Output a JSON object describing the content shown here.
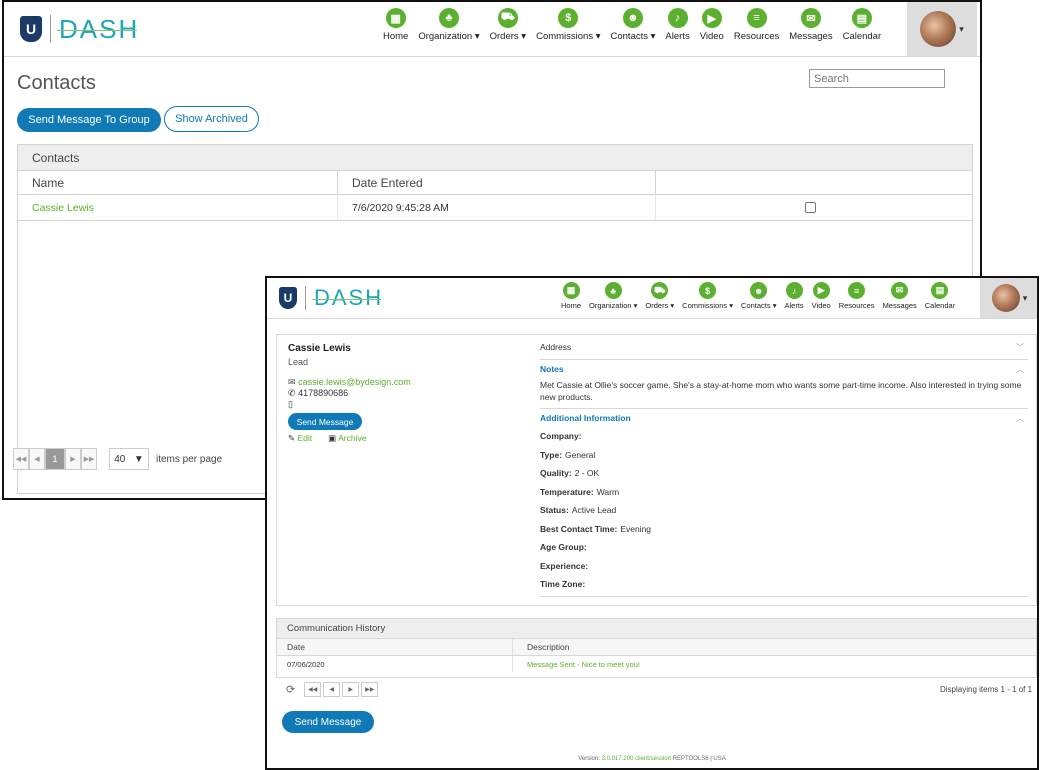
{
  "app": {
    "logo_mark": "U",
    "logo_text": "DASH"
  },
  "nav": [
    {
      "label": "Home",
      "icon": "home-icon",
      "glyph": "▦"
    },
    {
      "label": "Organization ▾",
      "icon": "organization-icon",
      "glyph": "♣"
    },
    {
      "label": "Orders ▾",
      "icon": "orders-icon",
      "glyph": "⛟"
    },
    {
      "label": "Commissions ▾",
      "icon": "commissions-icon",
      "glyph": "$"
    },
    {
      "label": "Contacts ▾",
      "icon": "contacts-icon",
      "glyph": "☻"
    },
    {
      "label": "Alerts",
      "icon": "alerts-icon",
      "glyph": "♪"
    },
    {
      "label": "Video",
      "icon": "video-icon",
      "glyph": "▶"
    },
    {
      "label": "Resources",
      "icon": "resources-icon",
      "glyph": "≡"
    },
    {
      "label": "Messages",
      "icon": "messages-icon",
      "glyph": "✉"
    },
    {
      "label": "Calendar",
      "icon": "calendar-icon",
      "glyph": "▤"
    }
  ],
  "contacts_page": {
    "title": "Contacts",
    "search_placeholder": "Search",
    "send_group_label": "Send Message To Group",
    "show_archived_label": "Show Archived",
    "grid_title": "Contacts",
    "columns": [
      "Name",
      "Date Entered",
      ""
    ],
    "rows": [
      {
        "name": "Cassie Lewis",
        "date": "7/6/2020 9:45:28 AM",
        "checked": false
      }
    ],
    "pager": {
      "current_page": "1",
      "page_size": "40",
      "items_label": "items per page"
    }
  },
  "contact_detail": {
    "name": "Cassie Lewis",
    "type": "Lead",
    "email": "cassie.lewis@bydesign.com",
    "phone": "4178890686",
    "mobile": "",
    "send_message_label": "Send Message",
    "edit_label": "Edit",
    "archive_label": "Archive",
    "address_label": "Address",
    "notes_label": "Notes",
    "notes_text": "Met Cassie at Ollie's soccer game. She's a stay-at-home mom who wants some part-time income. Also interested in trying some new products.",
    "additional_label": "Additional Information",
    "fields": [
      {
        "label": "Company:",
        "value": ""
      },
      {
        "label": "Type:",
        "value": "General"
      },
      {
        "label": "Quality:",
        "value": "2 - OK"
      },
      {
        "label": "Temperature:",
        "value": "Warm"
      },
      {
        "label": "Status:",
        "value": "Active Lead"
      },
      {
        "label": "Best Contact Time:",
        "value": "Evening"
      },
      {
        "label": "Age Group:",
        "value": ""
      },
      {
        "label": "Experience:",
        "value": ""
      },
      {
        "label": "Time Zone:",
        "value": ""
      }
    ],
    "history": {
      "title": "Communication History",
      "columns": [
        "Date",
        "Description"
      ],
      "rows": [
        {
          "date": "07/06/2020",
          "description": "Message Sent - Nice to meet you!"
        }
      ],
      "display_text": "Displaying items 1 - 1 of 1"
    },
    "send_message_label_2": "Send Message",
    "footer_prefix": "Version:",
    "footer_version": "3.0.017.200 client/session",
    "footer_suffix": "REPTOOLS6 | USA"
  },
  "colors": {
    "green": "#5bb12f",
    "blue": "#0f7ab6",
    "logo_teal": "#1ba6b8"
  }
}
